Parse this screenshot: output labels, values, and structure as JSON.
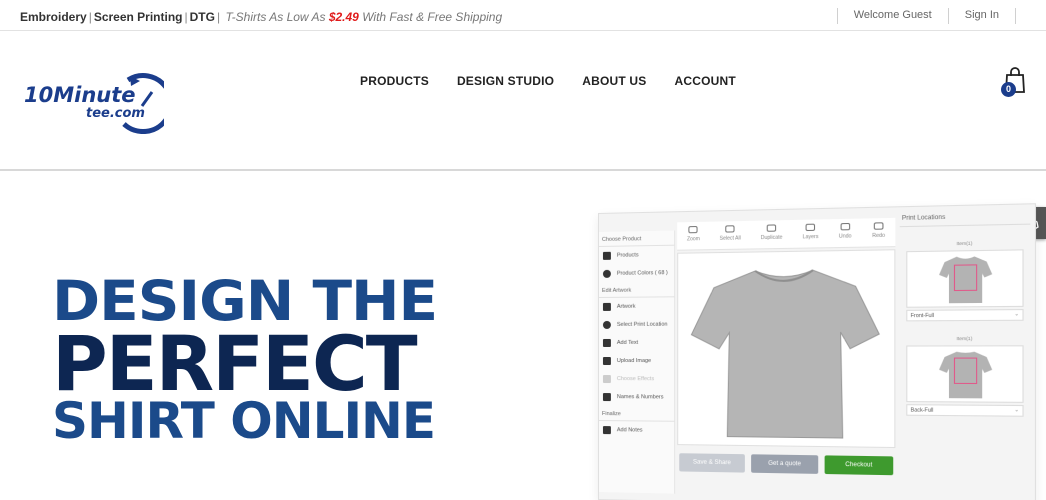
{
  "topbar": {
    "services": [
      "Embroidery",
      "Screen Printing",
      "DTG"
    ],
    "promo_prefix": "T-Shirts As Low As",
    "promo_price": "$2.49",
    "promo_suffix": "With Fast & Free Shipping",
    "welcome": "Welcome Guest",
    "signin": "Sign In"
  },
  "header": {
    "logo_main": "10Minute",
    "logo_sub": "tee.com",
    "nav": [
      "PRODUCTS",
      "DESIGN STUDIO",
      "ABOUT US",
      "ACCOUNT"
    ],
    "cart_count": "0"
  },
  "hero": {
    "line1": "DESIGN THE",
    "line2": "PERFECT",
    "line3": "SHIRT ONLINE"
  },
  "mockup": {
    "choose_product": "Choose Product",
    "products": "Products",
    "product_colors": "Product Colors ( 68 )",
    "edit_artwork": "Edit Artwork",
    "artwork": "Artwork",
    "select_print_location": "Select Print Location",
    "add_text": "Add Text",
    "upload_image": "Upload Image",
    "choose_effects": "Choose Effects",
    "names_numbers": "Names & Numbers",
    "finalize": "Finalize",
    "add_notes": "Add Notes",
    "tools": [
      "Zoom",
      "Select All",
      "Duplicate",
      "Layers",
      "Undo",
      "Redo"
    ],
    "save_share": "Save & Share",
    "get_quote": "Get a quote",
    "checkout": "Checkout",
    "print_locations": "Print Locations",
    "loc1_label": "Item(1)",
    "loc1_select": "Front-Full",
    "loc2_label": "Item(1)",
    "loc2_select": "Back-Full"
  },
  "colors": {
    "brand_blue": "#1b4a8a",
    "dark_navy": "#0d2652",
    "price_red": "#e01b1b",
    "checkout_green": "#3e9a2e"
  }
}
